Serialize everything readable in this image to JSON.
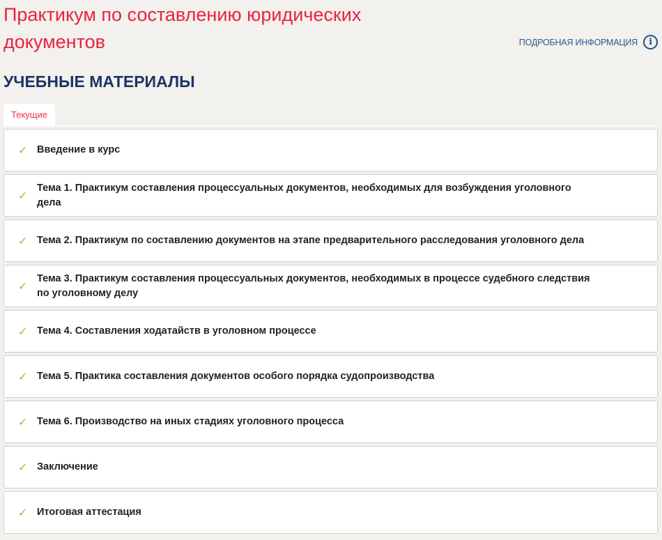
{
  "title": "Практикум по составлению юридических документов",
  "info_link": "ПОДРОБНАЯ ИНФОРМАЦИЯ",
  "section_title": "УЧЕБНЫЕ МАТЕРИАЛЫ",
  "tab": "Текущие",
  "items": [
    {
      "label": "Введение в курс",
      "done": true
    },
    {
      "label": "Тема 1. Практикум составления процессуальных документов, необходимых для возбуждения уголовного дела",
      "done": true
    },
    {
      "label": "Тема 2. Практикум по составлению документов на этапе предварительного расследования уголовного дела",
      "done": true
    },
    {
      "label": "Тема 3. Практикум составления процессуальных документов, необходимых в процессе судебного следствия по уголовному делу",
      "done": true
    },
    {
      "label": "Тема 4. Составления ходатайств в уголовном процессе",
      "done": true
    },
    {
      "label": "Тема 5. Практика составления документов особого порядка судопроизводства",
      "done": true
    },
    {
      "label": "Тема 6. Производство на иных стадиях уголовного процесса",
      "done": true
    },
    {
      "label": "Заключение",
      "done": true
    },
    {
      "label": "Итоговая аттестация",
      "done": true
    }
  ]
}
